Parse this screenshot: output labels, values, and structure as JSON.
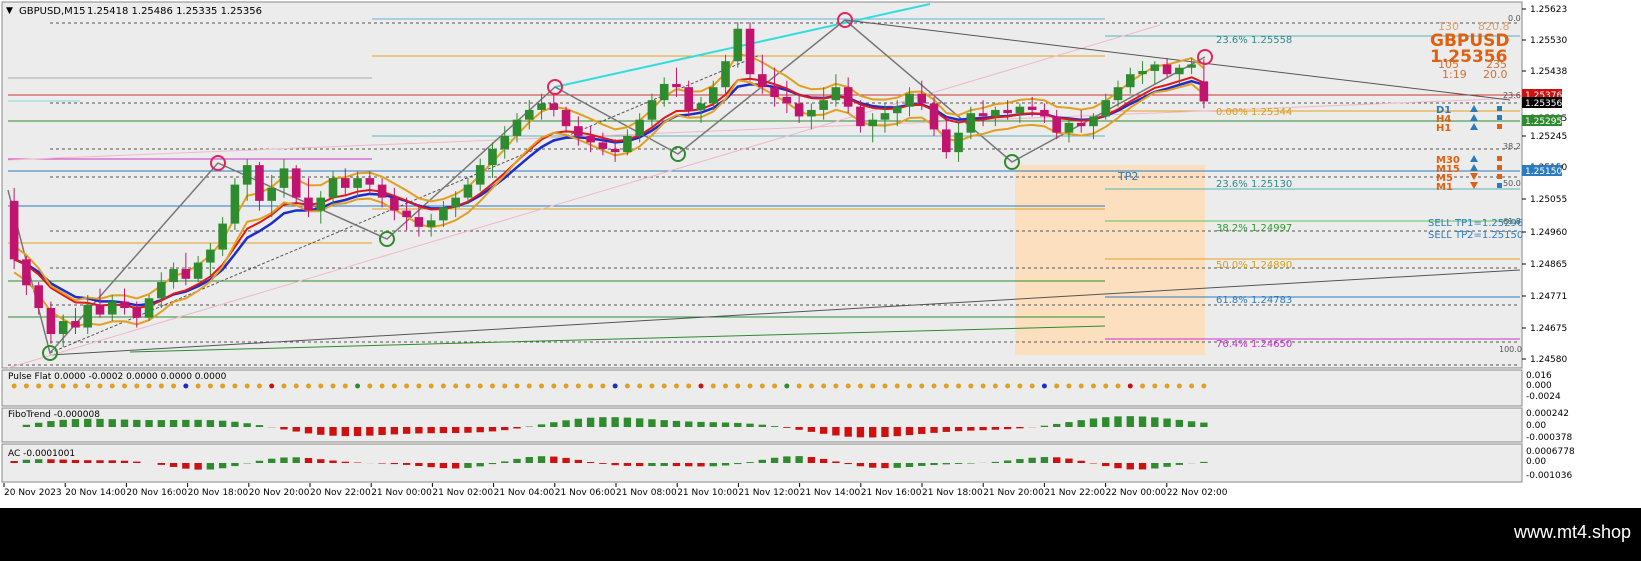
{
  "header": {
    "symbol_tf": "GBPUSD,M15",
    "ohlc": "1.25418 1.25486 1.25335 1.25356"
  },
  "info_panel": {
    "top_row": [
      "130",
      "820.8"
    ],
    "symbol": "GBPUSD",
    "price": "1.25356",
    "row2": [
      "105",
      "235"
    ],
    "row3": [
      "1:19",
      "20.0"
    ],
    "zero_label": "0.0"
  },
  "fibo_right": [
    {
      "label": "23.6%  1.25558",
      "color": "#2e8b8b"
    },
    {
      "label": "0.00%  1.25344",
      "color": "#d4a017"
    },
    {
      "label": "23.6%  1.25130",
      "color": "#2e8b8b"
    },
    {
      "label": "38.2%  1.24997",
      "color": "#2e9b2e"
    },
    {
      "label": "50.0%  1.24890",
      "color": "#d4a017"
    },
    {
      "label": "61.8%  1.24783",
      "color": "#2b7bbf"
    },
    {
      "label": "76.4%  1.24650",
      "color": "#cc33cc"
    },
    {
      "label": "100.0",
      "color": "#555555"
    }
  ],
  "fibo_mini": [
    "23.6",
    "38.2",
    "50.0",
    "61.8"
  ],
  "tp2_label": "TP2",
  "sell_targets": [
    "SELL TP1=1.25296",
    "SELL TP2=1.25150"
  ],
  "timeframes": [
    {
      "label": "D1",
      "color": "#2b7bbf",
      "arrow": "up",
      "square": "#2b7bbf"
    },
    {
      "label": "H4",
      "color": "#e06010",
      "arrow": "up",
      "square": "#2b7bbf"
    },
    {
      "label": "H1",
      "color": "#e06010",
      "arrow": "up",
      "square": "#e06010"
    },
    {
      "label": "M30",
      "color": "#e06010",
      "arrow": "up",
      "square": "#e06010"
    },
    {
      "label": "M15",
      "color": "#e06010",
      "arrow": "up",
      "square": "#e06010"
    },
    {
      "label": "M5",
      "color": "#e06010",
      "arrow": "down",
      "square": "#e06010"
    },
    {
      "label": "M1",
      "color": "#e06010",
      "arrow": "down",
      "square": "#2b7bbf"
    }
  ],
  "indicators": [
    {
      "name": "Pulse Flat 0.0000 -0.0002 0.0000 0.0000 0.0000",
      "axis": [
        "0.016",
        "0.000",
        "-0.0024"
      ]
    },
    {
      "name": "FiboTrend -0.000008",
      "axis": [
        "0.000242",
        "0.00",
        "-0.000378"
      ]
    },
    {
      "name": "AC -0.0001001",
      "axis": [
        "0.0006778",
        "0.00",
        "-0.001036"
      ]
    }
  ],
  "time_axis": [
    "20 Nov 2023",
    "20 Nov 14:00",
    "20 Nov 16:00",
    "20 Nov 18:00",
    "20 Nov 20:00",
    "20 Nov 22:00",
    "21 Nov 00:00",
    "21 Nov 02:00",
    "21 Nov 04:00",
    "21 Nov 06:00",
    "21 Nov 08:00",
    "21 Nov 10:00",
    "21 Nov 12:00",
    "21 Nov 14:00",
    "21 Nov 16:00",
    "21 Nov 18:00",
    "21 Nov 20:00",
    "21 Nov 22:00",
    "22 Nov 00:00",
    "22 Nov 02:00"
  ],
  "price_axis_labels": [
    "1.25623",
    "1.25530",
    "1.25438",
    "1.25295",
    "1.25245",
    "1.25150",
    "1.25055",
    "1.24960",
    "1.24865",
    "1.24771",
    "1.24675",
    "1.24580"
  ],
  "price_tags": [
    {
      "label": "1.25376",
      "bg": "#cc1111",
      "color": "#ffffff"
    },
    {
      "label": "1.25356",
      "bg": "#000000",
      "color": "#ffffff"
    },
    {
      "label": "1.25295",
      "bg": "#2e8b2e",
      "color": "#ffffff"
    },
    {
      "label": "1.25150",
      "bg": "#2b7bbf",
      "color": "#ffffff"
    }
  ],
  "brand": "www.mt4.shop",
  "chart_data": {
    "type": "candlestick",
    "title": "GBPUSD,M15",
    "ylim": [
      1.2456,
      1.2565
    ],
    "candles": [
      [
        1.2505,
        1.2509,
        1.2484,
        1.2487
      ],
      [
        1.2487,
        1.2488,
        1.2476,
        1.2479
      ],
      [
        1.2479,
        1.248,
        1.247,
        1.2472
      ],
      [
        1.2472,
        1.2474,
        1.2461,
        1.2464
      ],
      [
        1.2464,
        1.247,
        1.246,
        1.2468
      ],
      [
        1.2468,
        1.2472,
        1.2464,
        1.2466
      ],
      [
        1.2466,
        1.2476,
        1.2464,
        1.2473
      ],
      [
        1.2473,
        1.2478,
        1.2469,
        1.247
      ],
      [
        1.247,
        1.2476,
        1.2468,
        1.2474
      ],
      [
        1.2474,
        1.2478,
        1.247,
        1.2472
      ],
      [
        1.2472,
        1.2474,
        1.2466,
        1.2469
      ],
      [
        1.2469,
        1.2476,
        1.2468,
        1.2475
      ],
      [
        1.2475,
        1.2483,
        1.2472,
        1.248
      ],
      [
        1.248,
        1.2486,
        1.2478,
        1.2484
      ],
      [
        1.2484,
        1.2489,
        1.2479,
        1.2481
      ],
      [
        1.2481,
        1.2488,
        1.248,
        1.2486
      ],
      [
        1.2486,
        1.2492,
        1.2482,
        1.249
      ],
      [
        1.249,
        1.25,
        1.2488,
        1.2498
      ],
      [
        1.2498,
        1.2512,
        1.2496,
        1.251
      ],
      [
        1.251,
        1.2518,
        1.2505,
        1.2516
      ],
      [
        1.2516,
        1.2517,
        1.2502,
        1.2505
      ],
      [
        1.2505,
        1.2513,
        1.25,
        1.2509
      ],
      [
        1.2509,
        1.2518,
        1.2506,
        1.2515
      ],
      [
        1.2515,
        1.2516,
        1.2504,
        1.2506
      ],
      [
        1.2506,
        1.2512,
        1.25,
        1.2502
      ],
      [
        1.2502,
        1.2508,
        1.2498,
        1.2506
      ],
      [
        1.2506,
        1.2514,
        1.2504,
        1.2512
      ],
      [
        1.2512,
        1.2515,
        1.2507,
        1.2509
      ],
      [
        1.2509,
        1.2514,
        1.2506,
        1.2512
      ],
      [
        1.2512,
        1.2514,
        1.2507,
        1.251
      ],
      [
        1.251,
        1.2512,
        1.2503,
        1.2506
      ],
      [
        1.2506,
        1.2509,
        1.2499,
        1.2502
      ],
      [
        1.2502,
        1.2506,
        1.2496,
        1.25
      ],
      [
        1.25,
        1.2504,
        1.2494,
        1.2497
      ],
      [
        1.2497,
        1.2501,
        1.2494,
        1.2499
      ],
      [
        1.2499,
        1.2505,
        1.2497,
        1.2503
      ],
      [
        1.2503,
        1.2508,
        1.25,
        1.2506
      ],
      [
        1.2506,
        1.2512,
        1.2504,
        1.251
      ],
      [
        1.251,
        1.2518,
        1.2508,
        1.2516
      ],
      [
        1.2516,
        1.2523,
        1.2512,
        1.2521
      ],
      [
        1.2521,
        1.2528,
        1.2518,
        1.2525
      ],
      [
        1.2525,
        1.2532,
        1.2523,
        1.253
      ],
      [
        1.253,
        1.2536,
        1.2527,
        1.2533
      ],
      [
        1.2533,
        1.2538,
        1.253,
        1.2535
      ],
      [
        1.2535,
        1.2538,
        1.2531,
        1.2533
      ],
      [
        1.2533,
        1.2534,
        1.2526,
        1.2528
      ],
      [
        1.2528,
        1.2531,
        1.2522,
        1.2525
      ],
      [
        1.2525,
        1.2528,
        1.252,
        1.2523
      ],
      [
        1.2523,
        1.2526,
        1.2519,
        1.2521
      ],
      [
        1.2521,
        1.2524,
        1.2517,
        1.252
      ],
      [
        1.252,
        1.2527,
        1.2519,
        1.2525
      ],
      [
        1.2525,
        1.2532,
        1.2523,
        1.253
      ],
      [
        1.253,
        1.2538,
        1.2528,
        1.2536
      ],
      [
        1.2536,
        1.2543,
        1.2534,
        1.2541
      ],
      [
        1.2541,
        1.2546,
        1.2537,
        1.254
      ],
      [
        1.254,
        1.2542,
        1.2531,
        1.2533
      ],
      [
        1.2533,
        1.2537,
        1.2529,
        1.2535
      ],
      [
        1.2535,
        1.2542,
        1.2533,
        1.254
      ],
      [
        1.254,
        1.255,
        1.2538,
        1.2548
      ],
      [
        1.2548,
        1.256,
        1.2546,
        1.2558
      ],
      [
        1.2558,
        1.256,
        1.2542,
        1.2544
      ],
      [
        1.2544,
        1.255,
        1.2538,
        1.254
      ],
      [
        1.254,
        1.2546,
        1.2534,
        1.2537
      ],
      [
        1.2537,
        1.2542,
        1.2532,
        1.2535
      ],
      [
        1.2535,
        1.2538,
        1.2529,
        1.2531
      ],
      [
        1.2531,
        1.2535,
        1.2527,
        1.2533
      ],
      [
        1.2533,
        1.254,
        1.253,
        1.2536
      ],
      [
        1.2536,
        1.2544,
        1.2534,
        1.254
      ],
      [
        1.254,
        1.2543,
        1.2532,
        1.2534
      ],
      [
        1.2534,
        1.2536,
        1.2526,
        1.2528
      ],
      [
        1.2528,
        1.2532,
        1.2523,
        1.253
      ],
      [
        1.253,
        1.2535,
        1.2526,
        1.2532
      ],
      [
        1.2532,
        1.2536,
        1.2528,
        1.2534
      ],
      [
        1.2534,
        1.254,
        1.2531,
        1.2538
      ],
      [
        1.2538,
        1.2542,
        1.2533,
        1.2535
      ],
      [
        1.2535,
        1.2537,
        1.2525,
        1.2527
      ],
      [
        1.2527,
        1.2531,
        1.2518,
        1.252
      ],
      [
        1.252,
        1.2529,
        1.2517,
        1.2526
      ],
      [
        1.2526,
        1.2534,
        1.2524,
        1.2532
      ],
      [
        1.2532,
        1.2536,
        1.2528,
        1.2531
      ],
      [
        1.2531,
        1.2534,
        1.2528,
        1.2533
      ],
      [
        1.2533,
        1.2536,
        1.253,
        1.2532
      ],
      [
        1.2532,
        1.2535,
        1.2529,
        1.2534
      ],
      [
        1.2534,
        1.2537,
        1.2531,
        1.2533
      ],
      [
        1.2533,
        1.2535,
        1.2529,
        1.2531
      ],
      [
        1.2531,
        1.2533,
        1.2524,
        1.2526
      ],
      [
        1.2526,
        1.253,
        1.2523,
        1.2529
      ],
      [
        1.2529,
        1.2533,
        1.2526,
        1.2528
      ],
      [
        1.2528,
        1.2532,
        1.2524,
        1.2531
      ],
      [
        1.2531,
        1.2538,
        1.253,
        1.2536
      ],
      [
        1.2536,
        1.2542,
        1.2534,
        1.254
      ],
      [
        1.254,
        1.2546,
        1.2538,
        1.2544
      ],
      [
        1.2544,
        1.2548,
        1.2541,
        1.2545
      ],
      [
        1.2545,
        1.2548,
        1.2541,
        1.2547
      ],
      [
        1.2547,
        1.2549,
        1.2543,
        1.2544
      ],
      [
        1.2544,
        1.2547,
        1.2541,
        1.2546
      ],
      [
        1.2546,
        1.2549,
        1.2544,
        1.2547
      ],
      [
        1.25418,
        1.25486,
        1.25335,
        1.25356
      ]
    ],
    "fib_levels": [
      1.25558,
      1.25344,
      1.2513,
      1.24997,
      1.2489,
      1.24783,
      1.2465
    ],
    "sell_tp": [
      1.25296,
      1.2515
    ]
  }
}
